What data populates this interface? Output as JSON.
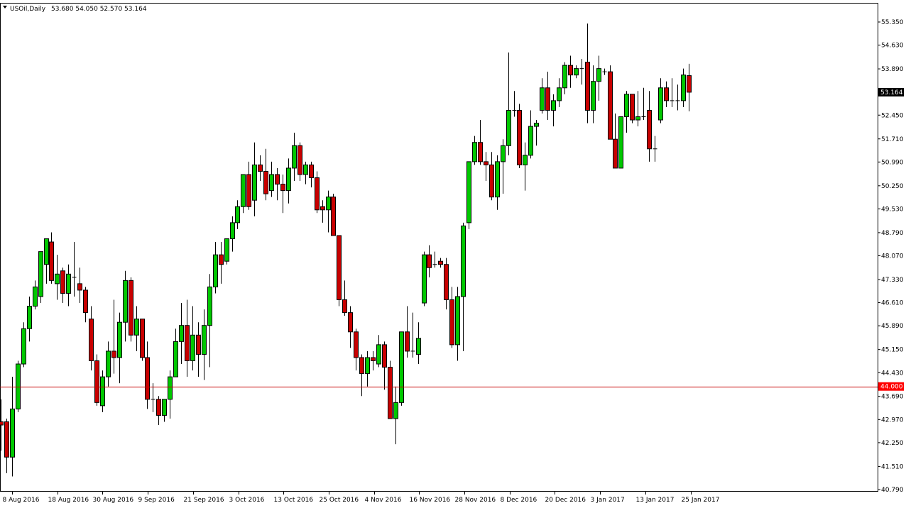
{
  "header": {
    "symbol": "USOil,Daily",
    "ohlc": "53.680 54.050 52.570 53.164"
  },
  "colors": {
    "bull": "#00c800",
    "bear": "#c80000",
    "wick": "#000000",
    "axis": "#000000",
    "hline": "#c80000",
    "last_tag_bg": "#000000",
    "last_tag_fg": "#ffffff",
    "level_tag_bg": "#ff0000",
    "level_tag_fg": "#ffffff"
  },
  "chart_data": {
    "type": "candlestick",
    "title": "USOil,Daily",
    "ylim": [
      40.79,
      55.61
    ],
    "y_ticks": [
      "55.350",
      "54.630",
      "53.890",
      "53.170",
      "52.450",
      "51.710",
      "50.990",
      "50.250",
      "49.530",
      "48.790",
      "48.070",
      "47.330",
      "46.610",
      "45.890",
      "45.150",
      "44.430",
      "43.690",
      "42.970",
      "42.250",
      "41.510",
      "40.790"
    ],
    "x_tick_labels": [
      "8 Aug 2016",
      "18 Aug 2016",
      "30 Aug 2016",
      "9 Sep 2016",
      "21 Sep 2016",
      "3 Oct 2016",
      "13 Oct 2016",
      "25 Oct 2016",
      "4 Nov 2016",
      "16 Nov 2016",
      "28 Nov 2016",
      "8 Dec 2016",
      "20 Dec 2016",
      "3 Jan 2017",
      "13 Jan 2017",
      "25 Jan 2017"
    ],
    "horizontal_line": 44.0,
    "horizontal_line_label": "44.000",
    "last_price": 53.164,
    "last_price_label": "53.164",
    "grid": false,
    "candles": [
      [
        42.9,
        43.6,
        42.0,
        42.8
      ],
      [
        42.9,
        43.0,
        41.3,
        41.8
      ],
      [
        41.8,
        44.3,
        41.2,
        43.3
      ],
      [
        43.3,
        44.8,
        43.2,
        44.7
      ],
      [
        44.7,
        46.0,
        44.6,
        45.8
      ],
      [
        45.8,
        46.8,
        45.4,
        46.5
      ],
      [
        46.5,
        47.3,
        46.4,
        47.1
      ],
      [
        46.8,
        48.2,
        46.6,
        48.2
      ],
      [
        47.8,
        48.6,
        47.2,
        48.6
      ],
      [
        48.5,
        48.8,
        47.2,
        47.3
      ],
      [
        47.2,
        48.1,
        46.7,
        47.5
      ],
      [
        47.6,
        47.7,
        46.6,
        46.9
      ],
      [
        46.9,
        47.8,
        46.5,
        47.5
      ],
      [
        47.4,
        48.5,
        46.8,
        47.4
      ],
      [
        47.2,
        47.7,
        46.6,
        47.0
      ],
      [
        47.0,
        47.1,
        46.0,
        46.3
      ],
      [
        46.1,
        46.5,
        44.5,
        44.8
      ],
      [
        44.8,
        45.0,
        43.4,
        43.5
      ],
      [
        43.4,
        44.5,
        43.2,
        44.3
      ],
      [
        44.3,
        45.4,
        44.0,
        45.1
      ],
      [
        45.1,
        46.7,
        44.4,
        44.9
      ],
      [
        44.9,
        46.3,
        44.1,
        46.0
      ],
      [
        46.0,
        47.6,
        45.4,
        47.3
      ],
      [
        47.3,
        47.4,
        45.4,
        45.6
      ],
      [
        45.6,
        46.5,
        45.1,
        46.1
      ],
      [
        46.1,
        46.1,
        44.8,
        44.9
      ],
      [
        44.9,
        45.4,
        43.3,
        43.6
      ],
      [
        43.6,
        44.1,
        43.2,
        43.6
      ],
      [
        43.6,
        43.7,
        42.8,
        43.1
      ],
      [
        43.1,
        43.6,
        42.9,
        43.6
      ],
      [
        43.6,
        44.5,
        43.0,
        44.3
      ],
      [
        44.3,
        45.8,
        44.3,
        45.4
      ],
      [
        45.4,
        46.6,
        44.7,
        45.9
      ],
      [
        45.9,
        46.7,
        44.3,
        44.8
      ],
      [
        44.8,
        46.5,
        44.5,
        45.6
      ],
      [
        45.6,
        46.0,
        44.3,
        45.0
      ],
      [
        45.0,
        46.4,
        44.2,
        45.9
      ],
      [
        45.9,
        47.5,
        44.6,
        47.1
      ],
      [
        47.1,
        48.5,
        46.9,
        48.1
      ],
      [
        48.1,
        48.5,
        47.2,
        47.8
      ],
      [
        47.9,
        48.6,
        47.8,
        48.6
      ],
      [
        48.6,
        49.3,
        48.2,
        49.1
      ],
      [
        49.1,
        49.8,
        48.9,
        49.6
      ],
      [
        49.6,
        50.6,
        49.4,
        50.6
      ],
      [
        50.6,
        51.0,
        49.5,
        49.6
      ],
      [
        49.8,
        51.6,
        49.3,
        50.9
      ],
      [
        50.9,
        51.2,
        50.4,
        50.7
      ],
      [
        50.7,
        51.4,
        49.8,
        50.0
      ],
      [
        50.1,
        51.0,
        49.9,
        50.6
      ],
      [
        50.6,
        50.8,
        49.8,
        50.3
      ],
      [
        50.3,
        50.6,
        49.4,
        50.1
      ],
      [
        50.1,
        51.1,
        49.7,
        50.8
      ],
      [
        50.8,
        51.9,
        50.4,
        51.5
      ],
      [
        51.5,
        51.6,
        50.4,
        50.6
      ],
      [
        50.6,
        51.0,
        50.3,
        50.9
      ],
      [
        50.9,
        51.0,
        50.2,
        50.5
      ],
      [
        50.5,
        50.7,
        49.4,
        49.5
      ],
      [
        49.6,
        49.8,
        49.1,
        49.5
      ],
      [
        49.5,
        50.1,
        48.8,
        49.9
      ],
      [
        49.9,
        50.0,
        48.8,
        48.7
      ],
      [
        48.7,
        48.5,
        46.5,
        46.7
      ],
      [
        46.7,
        47.3,
        46.2,
        46.3
      ],
      [
        46.3,
        46.5,
        45.2,
        45.7
      ],
      [
        45.7,
        45.8,
        44.5,
        44.9
      ],
      [
        44.9,
        45.0,
        43.7,
        44.4
      ],
      [
        44.4,
        45.1,
        44.0,
        44.9
      ],
      [
        44.9,
        45.1,
        44.5,
        44.8
      ],
      [
        44.7,
        45.6,
        44.6,
        45.3
      ],
      [
        45.3,
        45.4,
        43.9,
        44.6
      ],
      [
        44.6,
        44.8,
        43.0,
        43.0
      ],
      [
        43.0,
        44.0,
        42.2,
        43.5
      ],
      [
        43.5,
        45.6,
        43.4,
        45.7
      ],
      [
        45.7,
        46.5,
        44.9,
        45.1
      ],
      [
        45.1,
        46.3,
        44.9,
        45.1
      ],
      [
        45.0,
        46.0,
        44.7,
        45.5
      ],
      [
        46.6,
        48.2,
        46.5,
        48.1
      ],
      [
        48.1,
        48.4,
        47.4,
        47.7
      ],
      [
        47.8,
        48.2,
        47.7,
        47.8
      ],
      [
        47.9,
        48.0,
        47.7,
        47.8
      ],
      [
        47.8,
        48.0,
        46.4,
        46.7
      ],
      [
        46.7,
        47.1,
        45.2,
        45.3
      ],
      [
        45.3,
        47.1,
        44.8,
        46.8
      ],
      [
        46.8,
        49.1,
        45.1,
        49.0
      ],
      [
        49.1,
        50.9,
        48.9,
        51.0
      ],
      [
        51.0,
        51.8,
        50.9,
        51.6
      ],
      [
        51.6,
        52.3,
        50.9,
        51.0
      ],
      [
        51.0,
        51.3,
        50.4,
        50.9
      ],
      [
        50.9,
        51.3,
        49.8,
        49.9
      ],
      [
        49.9,
        51.2,
        49.5,
        51.0
      ],
      [
        51.0,
        51.7,
        50.0,
        51.5
      ],
      [
        51.5,
        54.4,
        51.2,
        52.6
      ],
      [
        52.6,
        53.2,
        52.4,
        52.6
      ],
      [
        52.6,
        52.8,
        50.8,
        50.9
      ],
      [
        50.9,
        51.6,
        50.1,
        51.2
      ],
      [
        51.2,
        52.6,
        51.1,
        52.1
      ],
      [
        52.1,
        52.3,
        51.5,
        52.2
      ],
      [
        52.6,
        53.6,
        52.5,
        53.3
      ],
      [
        53.3,
        53.8,
        52.3,
        52.6
      ],
      [
        52.6,
        53.1,
        52.1,
        52.9
      ],
      [
        52.9,
        53.6,
        52.7,
        53.3
      ],
      [
        53.3,
        54.1,
        53.1,
        54.0
      ],
      [
        54.0,
        54.3,
        53.3,
        53.7
      ],
      [
        53.7,
        54.0,
        53.6,
        53.9
      ],
      [
        53.9,
        54.2,
        53.4,
        53.9
      ],
      [
        54.1,
        55.3,
        52.2,
        52.6
      ],
      [
        52.6,
        54.0,
        52.2,
        53.5
      ],
      [
        53.5,
        54.3,
        52.9,
        53.9
      ],
      [
        53.8,
        53.9,
        53.7,
        53.8
      ],
      [
        53.8,
        54.0,
        51.7,
        51.7
      ],
      [
        51.7,
        52.5,
        50.8,
        50.8
      ],
      [
        50.8,
        52.4,
        50.8,
        52.4
      ],
      [
        52.4,
        53.2,
        51.9,
        53.1
      ],
      [
        53.1,
        53.1,
        52.2,
        52.3
      ],
      [
        52.3,
        53.2,
        52.1,
        52.4
      ],
      [
        52.4,
        53.3,
        52.3,
        52.4
      ],
      [
        52.6,
        53.2,
        51.0,
        51.4
      ],
      [
        51.4,
        51.8,
        51.0,
        51.4
      ],
      [
        52.3,
        53.6,
        52.2,
        53.3
      ],
      [
        53.3,
        53.5,
        52.7,
        52.9
      ],
      [
        52.9,
        53.6,
        52.7,
        52.9
      ],
      [
        52.9,
        53.4,
        52.6,
        52.9
      ],
      [
        52.9,
        53.9,
        52.7,
        53.7
      ],
      [
        53.68,
        54.05,
        52.57,
        53.164
      ]
    ]
  }
}
